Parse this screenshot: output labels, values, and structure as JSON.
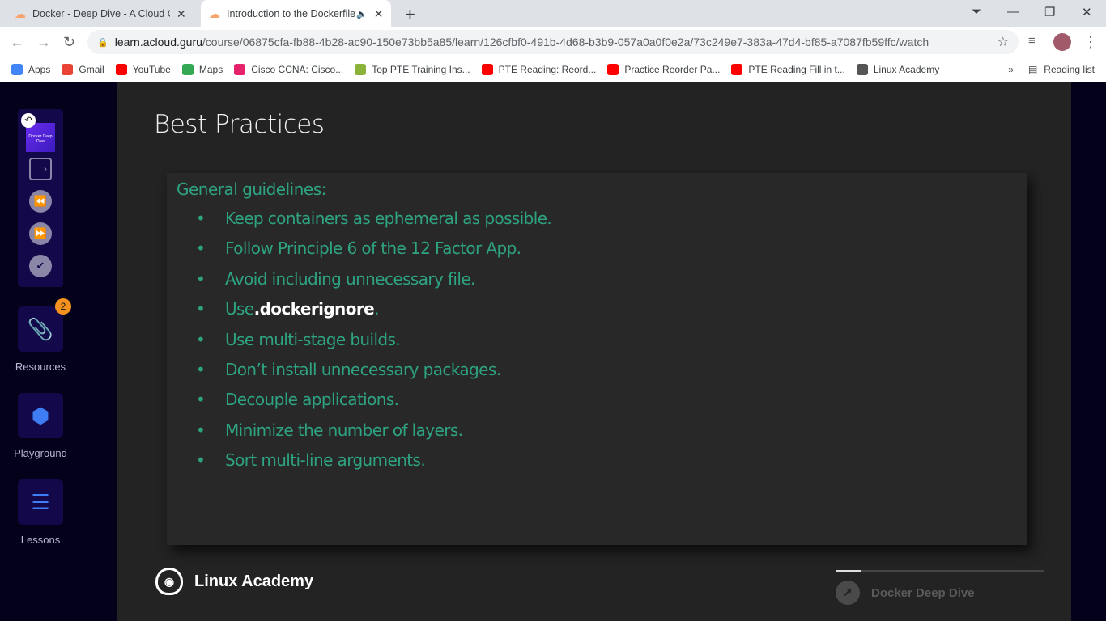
{
  "browser": {
    "tabs": [
      {
        "title": "Docker - Deep Dive - A Cloud Guru",
        "active": false
      },
      {
        "title": "Introduction to the Dockerfile",
        "active": true,
        "audio": true
      }
    ],
    "url_host": "learn.acloud.guru",
    "url_path": "/course/06875cfa-fb88-4b28-ac90-150e73bb5a85/learn/126cfbf0-491b-4d68-b3b9-057a0a0f0e2a/73c249e7-383a-47d4-bf85-a7087fb59ffc/watch",
    "bookmarks": [
      {
        "label": "Apps",
        "color": "#4285f4"
      },
      {
        "label": "Gmail",
        "color": "#ea4335"
      },
      {
        "label": "YouTube",
        "color": "#ff0000"
      },
      {
        "label": "Maps",
        "color": "#34a853"
      },
      {
        "label": "Cisco CCNA: Cisco...",
        "color": "#e5226b"
      },
      {
        "label": "Top PTE Training Ins...",
        "color": "#8bb33a"
      },
      {
        "label": "PTE Reading: Reord...",
        "color": "#ff0000"
      },
      {
        "label": "Practice Reorder Pa...",
        "color": "#ff0000"
      },
      {
        "label": "PTE Reading Fill in t...",
        "color": "#ff0000"
      },
      {
        "label": "Linux Academy",
        "color": "#555555"
      }
    ],
    "reading_list": "Reading list"
  },
  "sidebar": {
    "thumbnail_text": "Docker Deep Dive",
    "items": [
      {
        "label": "Resources",
        "badge": "2"
      },
      {
        "label": "Playground"
      },
      {
        "label": "Lessons"
      }
    ]
  },
  "slide": {
    "title": "Best Practices",
    "heading": "General guidelines:",
    "bullets": [
      "Keep containers as ephemeral as possible.",
      "Follow Principle 6 of the 12 Factor App.",
      "Avoid including unnecessary file.",
      "Use ",
      "Use multi-stage builds.",
      "Don’t install unnecessary packages.",
      "Decouple applications.",
      "Minimize the number of layers.",
      "Sort multi-line arguments."
    ],
    "bullet4_code": ".dockerignore",
    "bullet4_end": ".",
    "brand": "Linux Academy",
    "course": "Docker Deep Dive",
    "progress": 0.12
  }
}
